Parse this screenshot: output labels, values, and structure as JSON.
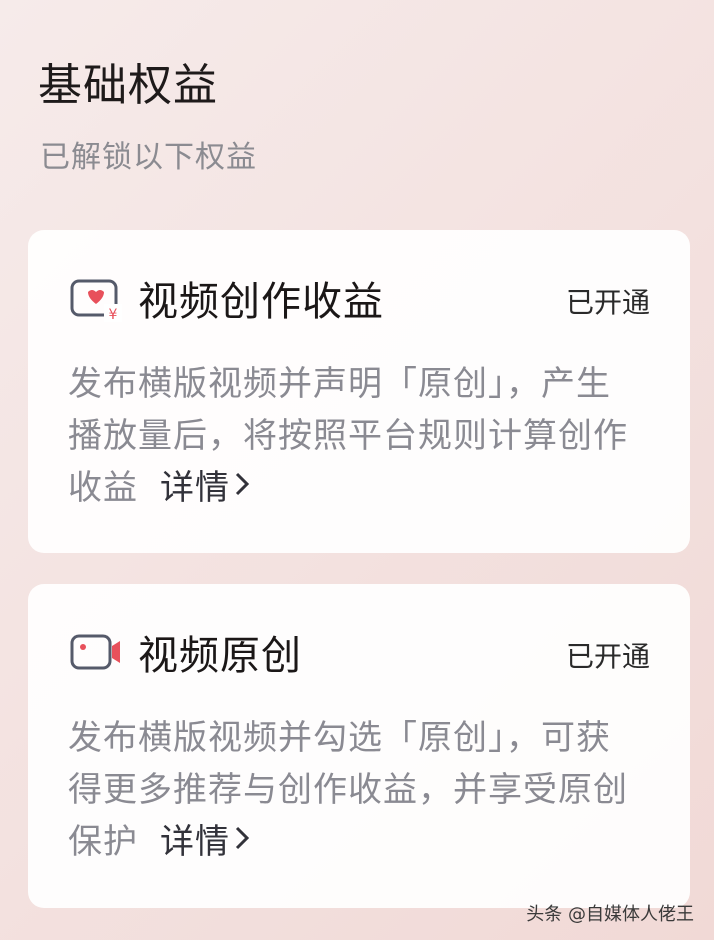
{
  "header": {
    "title": "基础权益",
    "subtitle": "已解锁以下权益"
  },
  "benefits": [
    {
      "title": "视频创作收益",
      "status": "已开通",
      "icon": "video-revenue-icon",
      "description_lines": [
        "发布横版视频并声明「原创」，产生",
        "播放量后，将按照平台规则计算创作",
        "收益"
      ],
      "detail_label": "详情"
    },
    {
      "title": "视频原创",
      "status": "已开通",
      "icon": "video-camera-icon",
      "description_lines": [
        "发布横版视频并勾选「原创」，可获",
        "得更多推荐与创作收益，并享受原创",
        "保护"
      ],
      "detail_label": "详情"
    }
  ],
  "watermark": "头条 @自媒体人佬王",
  "colors": {
    "accent_red": "#e8505b",
    "icon_gray": "#555a6a"
  }
}
